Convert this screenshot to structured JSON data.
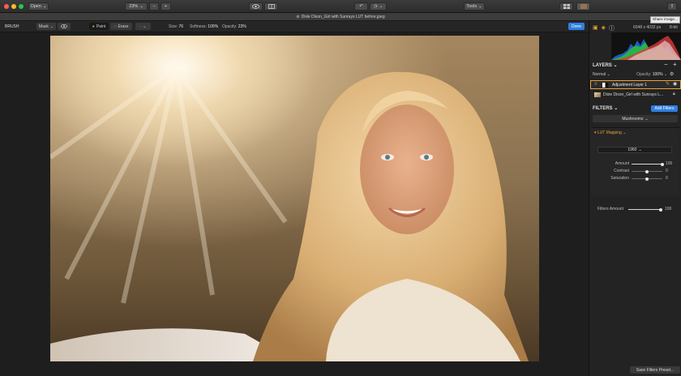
{
  "titlebar": {
    "open_label": "Open",
    "zoom_value": "23%",
    "tools_label": "Tools",
    "tooltip": "Share image..."
  },
  "document": {
    "title": "Dixie Dixon_Girl with Sunrays LUT before.jpeg"
  },
  "toolbar": {
    "mode_label": "BRUSH",
    "mask_label": "Mask",
    "paint_label": "Paint",
    "erase_label": "Erase",
    "size_label": "Size:",
    "size_value": "76",
    "softness_label": "Softness:",
    "softness_value": "100%",
    "opacity_label": "Opacity:",
    "opacity_value": "23%",
    "done_label": "Done"
  },
  "panel": {
    "image_size": "6048 x 4032 px",
    "bit_depth": "8-bit",
    "layers_title": "LAYERS",
    "blend_mode": "Normal",
    "opacity_label": "Opacity:",
    "opacity_value": "100%",
    "layers": [
      {
        "name": "Adjustment Layer 1"
      },
      {
        "name": "Dixie Dixon_Girl with Sunrays L..."
      }
    ],
    "filters_title": "FILTERS",
    "add_filters_label": "Add Filters",
    "filter_group": "Mushrooms",
    "filter_name": "LUT Mapping",
    "lut_value": "1960",
    "sliders": [
      {
        "label": "Amount",
        "value": "100",
        "fraction": 1.0
      },
      {
        "label": "Contrast",
        "value": "0",
        "fraction": 0.5
      },
      {
        "label": "Saturation",
        "value": "0",
        "fraction": 0.5
      }
    ],
    "filters_amount_label": "Filters Amount",
    "filters_amount_value": "100",
    "filters_amount_fraction": 1.0,
    "save_preset_label": "Save Filters Preset..."
  },
  "colors": {
    "accent": "#e8a33b",
    "primary_button": "#2f7fe0",
    "panel_bg": "#232323"
  }
}
